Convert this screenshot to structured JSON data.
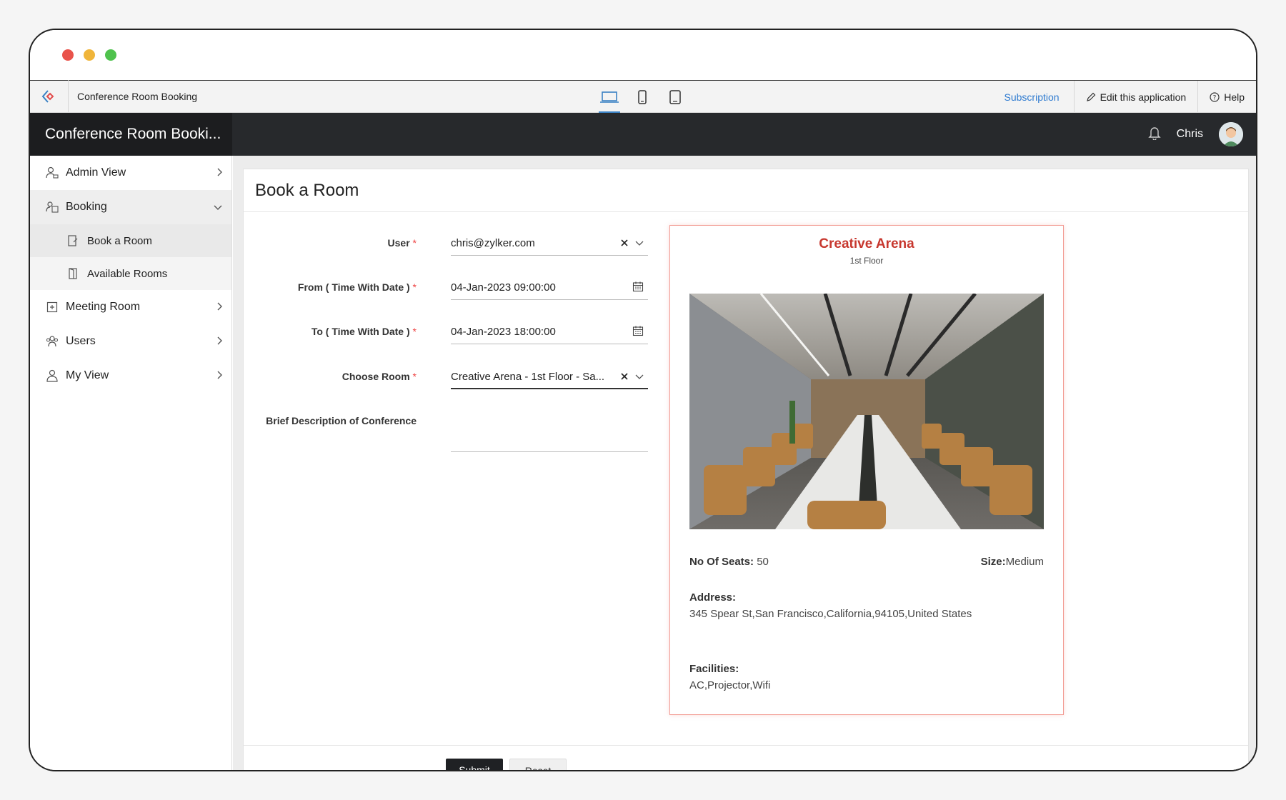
{
  "appbar": {
    "app_name": "Conference Room Booking",
    "subscription": "Subscription",
    "edit": "Edit this application",
    "help": "Help"
  },
  "header": {
    "title": "Conference Room Booki...",
    "user": "Chris"
  },
  "sidebar": {
    "items": [
      {
        "label": "Admin View"
      },
      {
        "label": "Booking"
      },
      {
        "label": "Book a Room"
      },
      {
        "label": "Available Rooms"
      },
      {
        "label": "Meeting Room"
      },
      {
        "label": "Users"
      },
      {
        "label": "My View"
      }
    ]
  },
  "form": {
    "title": "Book a Room",
    "required_mark": "*",
    "user_label": "User",
    "user_value": "chris@zylker.com",
    "from_label": "From ( Time With Date )",
    "from_value": "04-Jan-2023 09:00:00",
    "to_label": "To ( Time With Date )",
    "to_value": "04-Jan-2023 18:00:00",
    "room_label": "Choose Room",
    "room_value": "Creative Arena - 1st Floor - Sa...",
    "desc_label": "Brief Description of Conference",
    "submit": "Submit",
    "reset": "Reset"
  },
  "room": {
    "name": "Creative Arena",
    "floor": "1st Floor",
    "seats_label": "No Of Seats:",
    "seats_value": "50",
    "size_label": "Size:",
    "size_value": "Medium",
    "address_label": "Address:",
    "address_value": "345 Spear St,San Francisco,California,94105,United States",
    "facilities_label": "Facilities:",
    "facilities_value": "AC,Projector,Wifi"
  },
  "colors": {
    "accent": "#2f7bd0",
    "room_title": "#c7372e",
    "header_bg": "#27292c"
  }
}
